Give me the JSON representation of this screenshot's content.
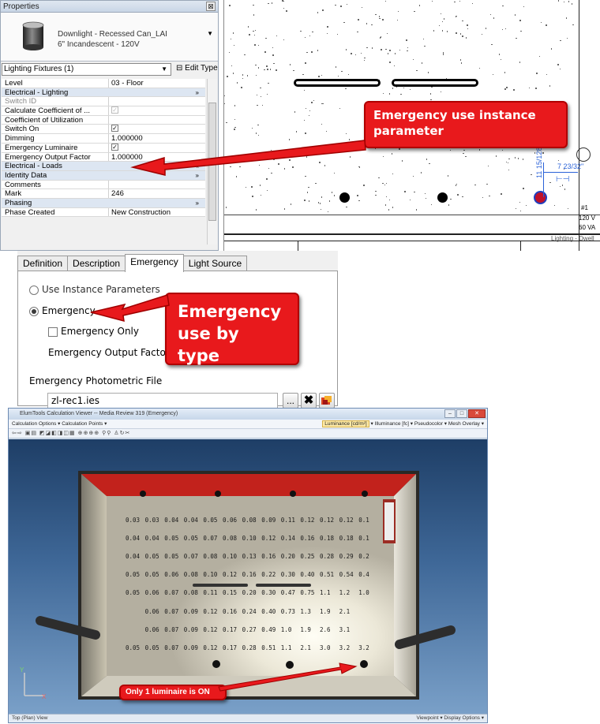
{
  "properties": {
    "title": "Properties",
    "type_line1": "Downlight - Recessed Can_LAI",
    "type_line2": "6\" Incandescent - 120V",
    "filter": "Lighting Fixtures (1)",
    "edit_type": "Edit Type",
    "rows": [
      {
        "k": "Level",
        "v": "03 - Floor",
        "kind": "text"
      },
      {
        "k": "Electrical - Lighting",
        "kind": "group",
        "chev": "»"
      },
      {
        "k": "Switch ID",
        "v": "",
        "kind": "text",
        "dis": true
      },
      {
        "k": "Calculate Coefficient of ...",
        "v": "✓",
        "kind": "checkdim"
      },
      {
        "k": "Coefficient of Utilization",
        "v": "",
        "kind": "text"
      },
      {
        "k": "Switch On",
        "v": "✓",
        "kind": "check"
      },
      {
        "k": "Dimming",
        "v": "1.000000",
        "kind": "text"
      },
      {
        "k": "Emergency Luminaire",
        "v": "✓",
        "kind": "check"
      },
      {
        "k": "Emergency Output Factor",
        "v": "1.000000",
        "kind": "text"
      },
      {
        "k": "Electrical - Loads",
        "kind": "group",
        "chev": "«"
      },
      {
        "k": "Identity Data",
        "kind": "group",
        "chev": "»"
      },
      {
        "k": "Comments",
        "v": "",
        "kind": "text"
      },
      {
        "k": "Mark",
        "v": "246",
        "kind": "text"
      },
      {
        "k": "Phasing",
        "kind": "group",
        "chev": "»"
      },
      {
        "k": "Phase Created",
        "v": "New Construction",
        "kind": "text"
      }
    ]
  },
  "plan": {
    "callout": "Emergency use instance parameter",
    "dim1": "7 23/32\"",
    "dim2": "11 15/128",
    "tag1": "#1",
    "tag2": "120 V",
    "tag3": "60 VA",
    "tag4": "Lighting - Dwell"
  },
  "type_dialog": {
    "tabs": [
      "Definition",
      "Description",
      "Emergency",
      "Light Source"
    ],
    "active_tab": 2,
    "opt_instance": "Use Instance Parameters",
    "opt_emergency": "Emergency",
    "emergency_only": "Emergency Only",
    "output_factor": "Emergency Output Factor",
    "file_label": "Emergency Photometric File",
    "file_value": "zl-rec1.ies",
    "browse": "...",
    "callout_line1": "Emergency",
    "callout_line2": "use by type"
  },
  "viewer": {
    "title": "ElumTools Calculation Viewer -- Media Review 319 (Emergency)",
    "menu_left": "Calculation Options ▾   Calculation Points ▾",
    "menu_lum": "Luminance [cd/m²]",
    "menu_right": "▾  Illuminance [fc] ▾   Pseudocolor ▾   Mesh Overlay ▾",
    "status_left": "Top (Plan) View",
    "status_right": "Viewpoint ▾   Display Options ▾",
    "callout": "Only 1 luminaire is ON",
    "axis_y": "Y",
    "axis_x": "X",
    "grid_rows": [
      [
        "0.03",
        "0.03",
        "0.04",
        "0.04",
        "0.05",
        "0.06",
        "0.08",
        "0.09",
        "0.11",
        "0.12",
        "0.12",
        "0.12",
        "0.1"
      ],
      [
        "0.04",
        "0.04",
        "0.05",
        "0.05",
        "0.07",
        "0.08",
        "0.10",
        "0.12",
        "0.14",
        "0.16",
        "0.18",
        "0.18",
        "0.1"
      ],
      [
        "0.04",
        "0.05",
        "0.05",
        "0.07",
        "0.08",
        "0.10",
        "0.13",
        "0.16",
        "0.20",
        "0.25",
        "0.28",
        "0.29",
        "0.2"
      ],
      [
        "0.05",
        "0.05",
        "0.06",
        "0.08",
        "0.10",
        "0.12",
        "0.16",
        "0.22",
        "0.30",
        "0.40",
        "0.51",
        "0.54",
        "0.4"
      ],
      [
        "0.05",
        "0.06",
        "0.07",
        "0.08",
        "0.11",
        "0.15",
        "0.20",
        "0.30",
        "0.47",
        "0.75",
        "1.1",
        "1.2",
        "1.0"
      ],
      [
        "",
        "0.06",
        "0.07",
        "0.09",
        "0.12",
        "0.16",
        "0.24",
        "0.40",
        "0.73",
        "1.3",
        "1.9",
        "2.1",
        ""
      ],
      [
        "",
        "0.06",
        "0.07",
        "0.09",
        "0.12",
        "0.17",
        "0.27",
        "0.49",
        "1.0",
        "1.9",
        "2.6",
        "3.1",
        ""
      ],
      [
        "0.05",
        "0.05",
        "0.07",
        "0.09",
        "0.12",
        "0.17",
        "0.28",
        "0.51",
        "1.1",
        "2.1",
        "3.0",
        "3.2",
        "3.2"
      ]
    ],
    "colors": {
      "ceiling_red": "#c2221c",
      "callout_red": "#e8191c"
    }
  }
}
